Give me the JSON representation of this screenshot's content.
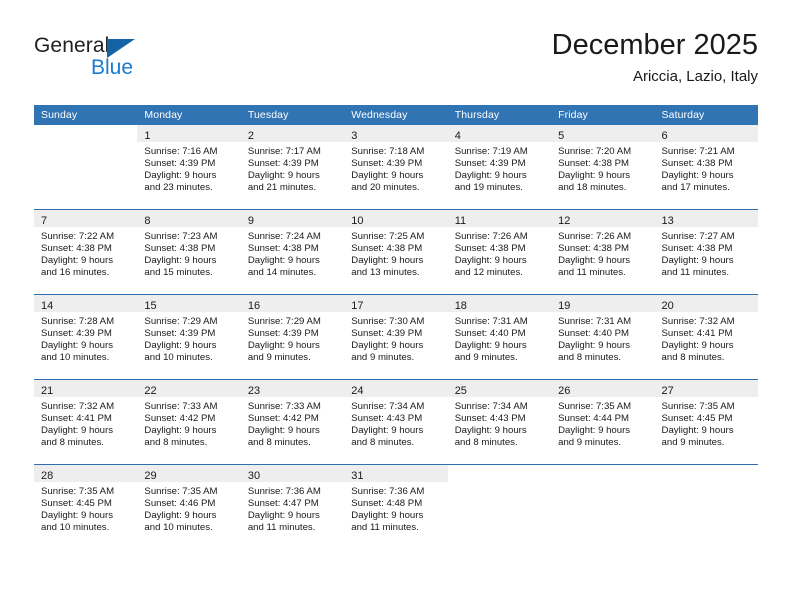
{
  "brand": {
    "name_part1": "General",
    "name_part2": "Blue",
    "triangle_color": "#1463a5",
    "blue_text_color": "#1b7ad1"
  },
  "header": {
    "title": "December 2025",
    "subtitle": "Ariccia, Lazio, Italy"
  },
  "theme": {
    "header_row_background": "#3174b4",
    "header_row_text": "#ffffff",
    "week_separator": "#2f6fae",
    "daynum_band_background": "#eeeeee",
    "page_background": "#ffffff",
    "text": "#1a1a1a"
  },
  "columns": [
    "Sunday",
    "Monday",
    "Tuesday",
    "Wednesday",
    "Thursday",
    "Friday",
    "Saturday"
  ],
  "weeks": [
    [
      {
        "day": "",
        "lines": []
      },
      {
        "day": "1",
        "lines": [
          "Sunrise: 7:16 AM",
          "Sunset: 4:39 PM",
          "Daylight: 9 hours",
          "and 23 minutes."
        ]
      },
      {
        "day": "2",
        "lines": [
          "Sunrise: 7:17 AM",
          "Sunset: 4:39 PM",
          "Daylight: 9 hours",
          "and 21 minutes."
        ]
      },
      {
        "day": "3",
        "lines": [
          "Sunrise: 7:18 AM",
          "Sunset: 4:39 PM",
          "Daylight: 9 hours",
          "and 20 minutes."
        ]
      },
      {
        "day": "4",
        "lines": [
          "Sunrise: 7:19 AM",
          "Sunset: 4:39 PM",
          "Daylight: 9 hours",
          "and 19 minutes."
        ]
      },
      {
        "day": "5",
        "lines": [
          "Sunrise: 7:20 AM",
          "Sunset: 4:38 PM",
          "Daylight: 9 hours",
          "and 18 minutes."
        ]
      },
      {
        "day": "6",
        "lines": [
          "Sunrise: 7:21 AM",
          "Sunset: 4:38 PM",
          "Daylight: 9 hours",
          "and 17 minutes."
        ]
      }
    ],
    [
      {
        "day": "7",
        "lines": [
          "Sunrise: 7:22 AM",
          "Sunset: 4:38 PM",
          "Daylight: 9 hours",
          "and 16 minutes."
        ]
      },
      {
        "day": "8",
        "lines": [
          "Sunrise: 7:23 AM",
          "Sunset: 4:38 PM",
          "Daylight: 9 hours",
          "and 15 minutes."
        ]
      },
      {
        "day": "9",
        "lines": [
          "Sunrise: 7:24 AM",
          "Sunset: 4:38 PM",
          "Daylight: 9 hours",
          "and 14 minutes."
        ]
      },
      {
        "day": "10",
        "lines": [
          "Sunrise: 7:25 AM",
          "Sunset: 4:38 PM",
          "Daylight: 9 hours",
          "and 13 minutes."
        ]
      },
      {
        "day": "11",
        "lines": [
          "Sunrise: 7:26 AM",
          "Sunset: 4:38 PM",
          "Daylight: 9 hours",
          "and 12 minutes."
        ]
      },
      {
        "day": "12",
        "lines": [
          "Sunrise: 7:26 AM",
          "Sunset: 4:38 PM",
          "Daylight: 9 hours",
          "and 11 minutes."
        ]
      },
      {
        "day": "13",
        "lines": [
          "Sunrise: 7:27 AM",
          "Sunset: 4:38 PM",
          "Daylight: 9 hours",
          "and 11 minutes."
        ]
      }
    ],
    [
      {
        "day": "14",
        "lines": [
          "Sunrise: 7:28 AM",
          "Sunset: 4:39 PM",
          "Daylight: 9 hours",
          "and 10 minutes."
        ]
      },
      {
        "day": "15",
        "lines": [
          "Sunrise: 7:29 AM",
          "Sunset: 4:39 PM",
          "Daylight: 9 hours",
          "and 10 minutes."
        ]
      },
      {
        "day": "16",
        "lines": [
          "Sunrise: 7:29 AM",
          "Sunset: 4:39 PM",
          "Daylight: 9 hours",
          "and 9 minutes."
        ]
      },
      {
        "day": "17",
        "lines": [
          "Sunrise: 7:30 AM",
          "Sunset: 4:39 PM",
          "Daylight: 9 hours",
          "and 9 minutes."
        ]
      },
      {
        "day": "18",
        "lines": [
          "Sunrise: 7:31 AM",
          "Sunset: 4:40 PM",
          "Daylight: 9 hours",
          "and 9 minutes."
        ]
      },
      {
        "day": "19",
        "lines": [
          "Sunrise: 7:31 AM",
          "Sunset: 4:40 PM",
          "Daylight: 9 hours",
          "and 8 minutes."
        ]
      },
      {
        "day": "20",
        "lines": [
          "Sunrise: 7:32 AM",
          "Sunset: 4:41 PM",
          "Daylight: 9 hours",
          "and 8 minutes."
        ]
      }
    ],
    [
      {
        "day": "21",
        "lines": [
          "Sunrise: 7:32 AM",
          "Sunset: 4:41 PM",
          "Daylight: 9 hours",
          "and 8 minutes."
        ]
      },
      {
        "day": "22",
        "lines": [
          "Sunrise: 7:33 AM",
          "Sunset: 4:42 PM",
          "Daylight: 9 hours",
          "and 8 minutes."
        ]
      },
      {
        "day": "23",
        "lines": [
          "Sunrise: 7:33 AM",
          "Sunset: 4:42 PM",
          "Daylight: 9 hours",
          "and 8 minutes."
        ]
      },
      {
        "day": "24",
        "lines": [
          "Sunrise: 7:34 AM",
          "Sunset: 4:43 PM",
          "Daylight: 9 hours",
          "and 8 minutes."
        ]
      },
      {
        "day": "25",
        "lines": [
          "Sunrise: 7:34 AM",
          "Sunset: 4:43 PM",
          "Daylight: 9 hours",
          "and 8 minutes."
        ]
      },
      {
        "day": "26",
        "lines": [
          "Sunrise: 7:35 AM",
          "Sunset: 4:44 PM",
          "Daylight: 9 hours",
          "and 9 minutes."
        ]
      },
      {
        "day": "27",
        "lines": [
          "Sunrise: 7:35 AM",
          "Sunset: 4:45 PM",
          "Daylight: 9 hours",
          "and 9 minutes."
        ]
      }
    ],
    [
      {
        "day": "28",
        "lines": [
          "Sunrise: 7:35 AM",
          "Sunset: 4:45 PM",
          "Daylight: 9 hours",
          "and 10 minutes."
        ]
      },
      {
        "day": "29",
        "lines": [
          "Sunrise: 7:35 AM",
          "Sunset: 4:46 PM",
          "Daylight: 9 hours",
          "and 10 minutes."
        ]
      },
      {
        "day": "30",
        "lines": [
          "Sunrise: 7:36 AM",
          "Sunset: 4:47 PM",
          "Daylight: 9 hours",
          "and 11 minutes."
        ]
      },
      {
        "day": "31",
        "lines": [
          "Sunrise: 7:36 AM",
          "Sunset: 4:48 PM",
          "Daylight: 9 hours",
          "and 11 minutes."
        ]
      },
      {
        "day": "",
        "lines": []
      },
      {
        "day": "",
        "lines": []
      },
      {
        "day": "",
        "lines": []
      }
    ]
  ]
}
